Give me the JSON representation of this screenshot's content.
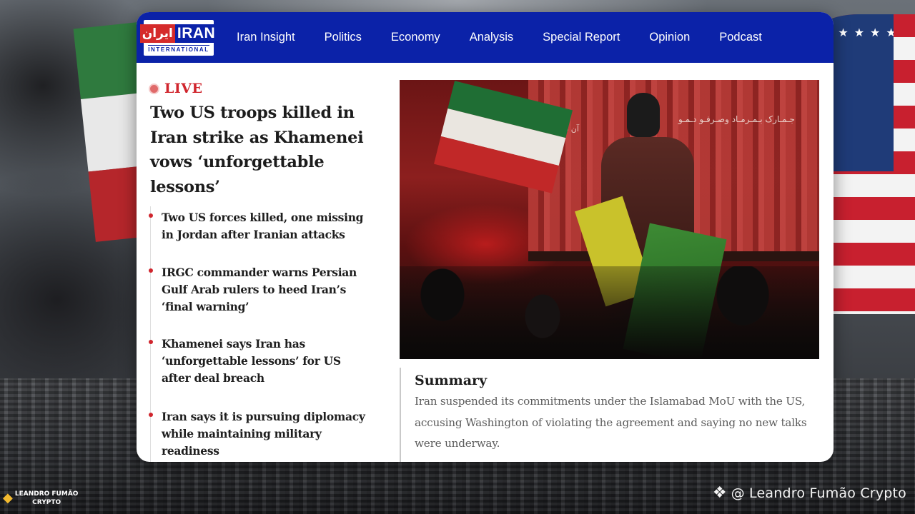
{
  "logo": {
    "fa_text": "ایران",
    "en_text": "IRAN",
    "subtitle": "INTERNATIONAL"
  },
  "nav": {
    "items": [
      {
        "label": "Iran Insight"
      },
      {
        "label": "Politics"
      },
      {
        "label": "Economy"
      },
      {
        "label": "Analysis"
      },
      {
        "label": "Special Report"
      },
      {
        "label": "Opinion"
      },
      {
        "label": "Podcast"
      }
    ]
  },
  "live": {
    "label": "LIVE",
    "color": "#d0252d"
  },
  "headline": "Two US troops killed in Iran strike as Khamenei vows ‘unforgettable lessons’",
  "bullets": [
    {
      "text": "Two US forces killed, one missing in Jordan after Iranian attacks"
    },
    {
      "text": "IRGC commander warns Persian Gulf Arab rulers to heed Iran’s ‘final warning’"
    },
    {
      "text": "Khamenei says Iran has ‘unforgettable lessons’ for US after deal breach"
    },
    {
      "text": "Iran says it is pursuing diplomacy while maintaining military readiness"
    }
  ],
  "hero_image": {
    "stage_text_right": "جـمـارک بـمـرمـاد وصـرفـو دـمـو",
    "stage_text_left": "آن شـب قـدر"
  },
  "summary": {
    "title": "Summary",
    "body": "Iran suspended its commitments under the Islamabad MoU with the US, accusing Washington of violating the agreement and saying no new talks were underway."
  },
  "watermarks": {
    "left_line1": "LEANDRO FUMÃO",
    "left_line2": "CRYPTO",
    "right_text": "@ Leandro Fumão Crypto"
  },
  "colors": {
    "nav_bg": "#0b22a8",
    "accent_red": "#d0252d",
    "logo_red": "#d52b2b"
  }
}
